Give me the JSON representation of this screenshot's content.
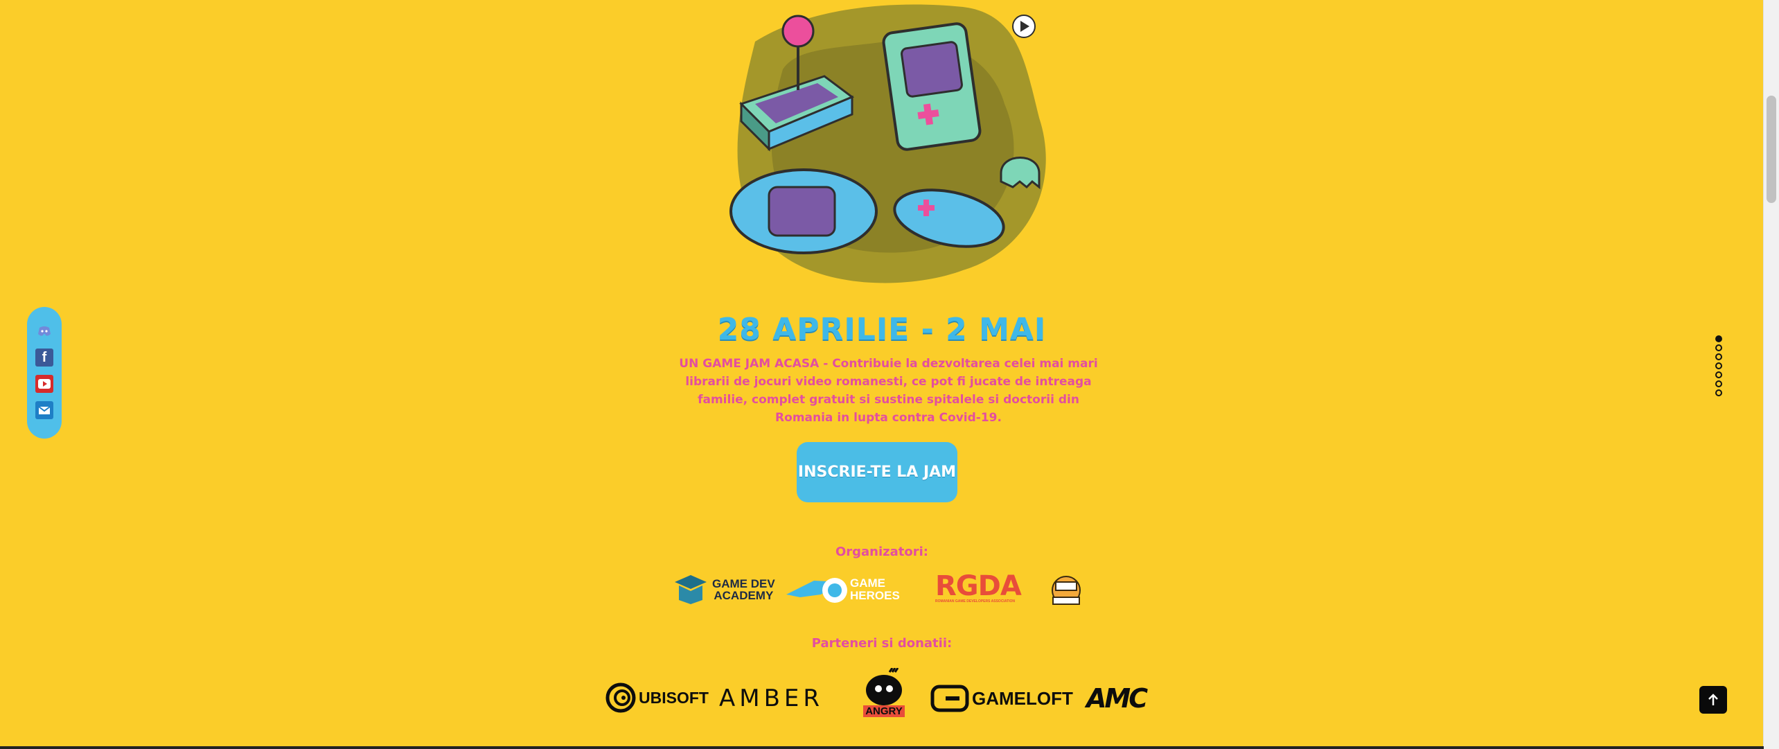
{
  "hero": {
    "date_title": "28 APRILIE - 2 MAI",
    "description": "UN GAME JAM ACASA - Contribuie la dezvoltarea celei mai mari librarii de jocuri video romanesti, ce pot fi jucate de intreaga familie, complet gratuit si sustine spitalele si doctorii din Romania in lupta contra Covid-19.",
    "cta_label": "INSCRIE-TE LA JAM"
  },
  "organizers": {
    "label": "Organizatori:",
    "logos": {
      "gda_line1": "GAME DEV",
      "gda_line2": "ACADEMY",
      "gh_line1": "GAME",
      "gh_line2": "HEROES",
      "rgda": "RGDA",
      "rgda_sub": "ROMANIAN GAME DEVELOPERS ASSOCIATION"
    }
  },
  "partners": {
    "label": "Parteneri si donatii:",
    "logos": {
      "ubisoft": "UBISOFT",
      "amber": "AMBER",
      "angry": "ANGRY",
      "gameloft": "GAMELOFT",
      "amc": "AMC"
    }
  },
  "social": {
    "icons": [
      "discord-icon",
      "facebook-icon",
      "youtube-icon",
      "email-icon"
    ]
  },
  "colors": {
    "background": "#fbcd29",
    "accent_blue": "#4bbde6",
    "accent_pink": "#e34ea0"
  },
  "dots_nav": {
    "count": 7,
    "active_index": 0
  }
}
